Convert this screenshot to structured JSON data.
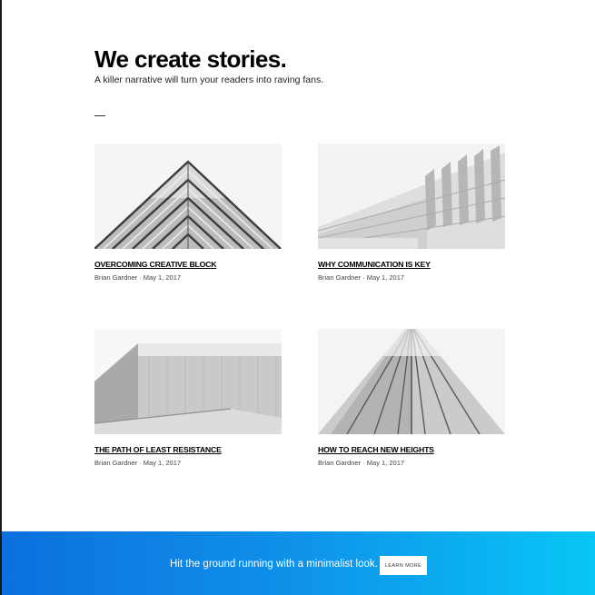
{
  "hero": {
    "title": "We create stories.",
    "subtitle": "A killer narrative will turn your readers into raving fans."
  },
  "posts": [
    {
      "title": "OVERCOMING CREATIVE BLOCK",
      "author": "Brian Gardner",
      "date": "May 1, 2017"
    },
    {
      "title": "WHY COMMUNICATION IS KEY",
      "author": "Brian Gardner",
      "date": "May 1, 2017"
    },
    {
      "title": "THE PATH OF LEAST RESISTANCE",
      "author": "Brian Gardner",
      "date": "May 1, 2017"
    },
    {
      "title": "HOW TO REACH NEW HEIGHTS",
      "author": "Brian Gardner",
      "date": "May 1, 2017"
    }
  ],
  "meta_separator": "·",
  "cta": {
    "text": "Hit the ground running with a minimalist look.",
    "button_label": "LEARN MORE"
  },
  "colors": {
    "cta_gradient_start": "#0c70dd",
    "cta_gradient_end": "#08c6f6",
    "text": "#000000"
  }
}
